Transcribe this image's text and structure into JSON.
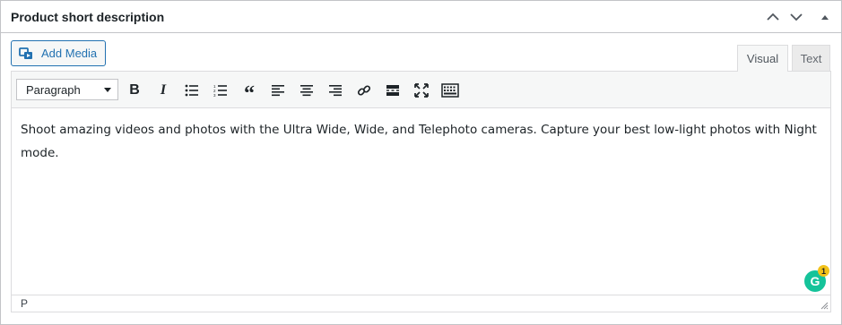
{
  "panel": {
    "title": "Product short description"
  },
  "header_buttons": {
    "move_up_icon": "chevron-up-icon",
    "move_down_icon": "chevron-down-icon",
    "toggle_icon": "triangle-up-icon"
  },
  "media": {
    "add_media_label": "Add Media"
  },
  "tabs": {
    "visual": "Visual",
    "text": "Text",
    "active": "Visual"
  },
  "toolbar": {
    "format_value": "Paragraph",
    "buttons": [
      "bold-icon",
      "italic-icon",
      "bulleted-list-icon",
      "numbered-list-icon",
      "blockquote-icon",
      "align-left-icon",
      "align-center-icon",
      "align-right-icon",
      "link-icon",
      "read-more-icon",
      "fullscreen-icon",
      "toolbar-toggle-icon"
    ]
  },
  "editor": {
    "content": "Shoot amazing videos and photos with the Ultra Wide, Wide, and Telephoto cameras. Capture your best low-light photos with Night mode.",
    "path": "P"
  },
  "grammarly": {
    "letter": "G",
    "count": "1"
  },
  "colors": {
    "accent": "#2271b1",
    "border": "#c3c4c7",
    "grammarly": "#15c39a",
    "badge": "#f2c21b"
  }
}
